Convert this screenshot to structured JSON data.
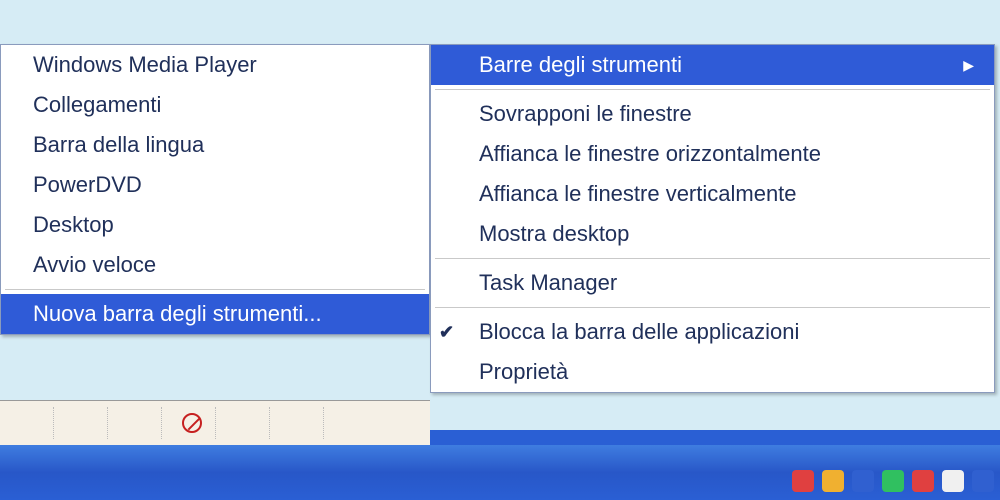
{
  "main_menu": {
    "items": [
      {
        "label": "Barre degli strumenti",
        "has_submenu": true,
        "highlighted": true
      },
      {
        "label": "Sovrapponi le finestre"
      },
      {
        "label": "Affianca le finestre orizzontalmente"
      },
      {
        "label": "Affianca le finestre verticalmente"
      },
      {
        "label": "Mostra desktop"
      },
      {
        "label": "Task Manager"
      },
      {
        "label": "Blocca la barra delle applicazioni",
        "checked": true
      },
      {
        "label": "Proprietà"
      }
    ]
  },
  "submenu": {
    "items": [
      {
        "label": "Windows Media Player"
      },
      {
        "label": "Collegamenti"
      },
      {
        "label": "Barra della lingua"
      },
      {
        "label": "PowerDVD"
      },
      {
        "label": "Desktop"
      },
      {
        "label": "Avvio veloce"
      },
      {
        "label": "Nuova barra degli strumenti...",
        "highlighted": true
      }
    ]
  },
  "icons": {
    "blocked": "blocked-icon",
    "arrow_right": "▶",
    "check": "✔"
  },
  "tray_colors": [
    "#e04040",
    "#f0b030",
    "#3060d0",
    "#30c060",
    "#e04040",
    "#f0f0f0",
    "#3060d0"
  ]
}
